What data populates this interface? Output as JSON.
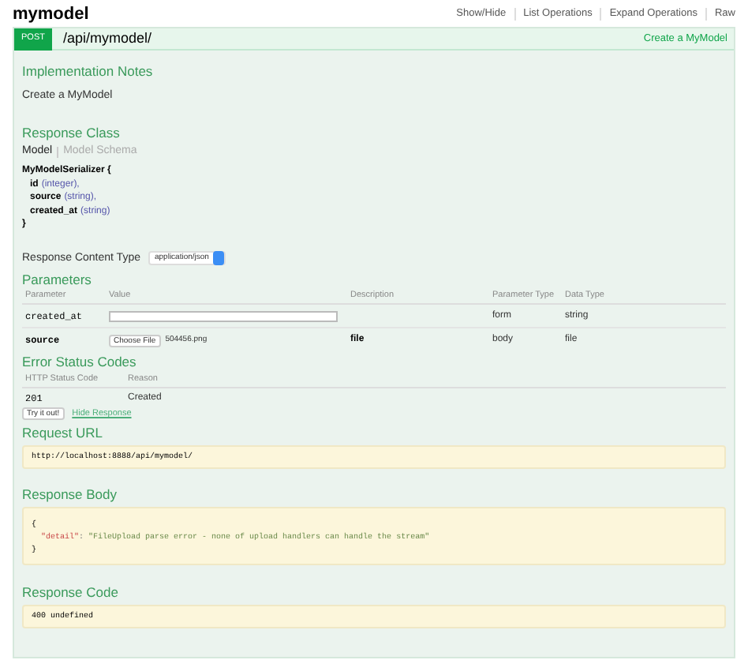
{
  "resource": {
    "title": "mymodel",
    "links": [
      "Show/Hide",
      "List Operations",
      "Expand Operations",
      "Raw"
    ]
  },
  "operation": {
    "method": "POST",
    "path": "/api/mymodel/",
    "summary": "Create a MyModel"
  },
  "implementation_notes": {
    "heading": "Implementation Notes",
    "text": "Create a MyModel"
  },
  "response_class": {
    "heading": "Response Class",
    "tabs": [
      {
        "label": "Model",
        "selected": true
      },
      {
        "label": "Model Schema",
        "selected": false
      }
    ],
    "model_name": "MyModelSerializer {",
    "fields": [
      {
        "name": "id",
        "type": "(integer),"
      },
      {
        "name": "source",
        "type": "(string),"
      },
      {
        "name": "created_at",
        "type": "(string)"
      }
    ],
    "closing": "}"
  },
  "response_content_type": {
    "label": "Response Content Type",
    "value": "application/json"
  },
  "parameters": {
    "heading": "Parameters",
    "columns": [
      "Parameter",
      "Value",
      "Description",
      "Parameter Type",
      "Data Type"
    ],
    "rows": [
      {
        "kind": "text",
        "name": "created_at",
        "description": "",
        "parameter_type": "form",
        "data_type": "string"
      },
      {
        "kind": "file",
        "name": "source",
        "button": "Choose File",
        "file_name": "504456.png",
        "description": "file",
        "parameter_type": "body",
        "data_type": "file"
      }
    ]
  },
  "error_status_codes": {
    "heading": "Error Status Codes",
    "columns": [
      "HTTP Status Code",
      "Reason"
    ],
    "rows": [
      {
        "code": "201",
        "reason": "Created"
      }
    ]
  },
  "actions": {
    "try_button": "Try it out!",
    "hide_link": "Hide Response"
  },
  "request_url": {
    "heading": "Request URL",
    "value": "http://localhost:8888/api/mymodel/"
  },
  "response_body": {
    "heading": "Response Body",
    "open": "{",
    "key": "\"detail\"",
    "separator": ": ",
    "value": "\"FileUpload parse error - none of upload handlers can handle the stream\"",
    "close": "}"
  },
  "response_code": {
    "heading": "Response Code",
    "value": "400 undefined"
  }
}
